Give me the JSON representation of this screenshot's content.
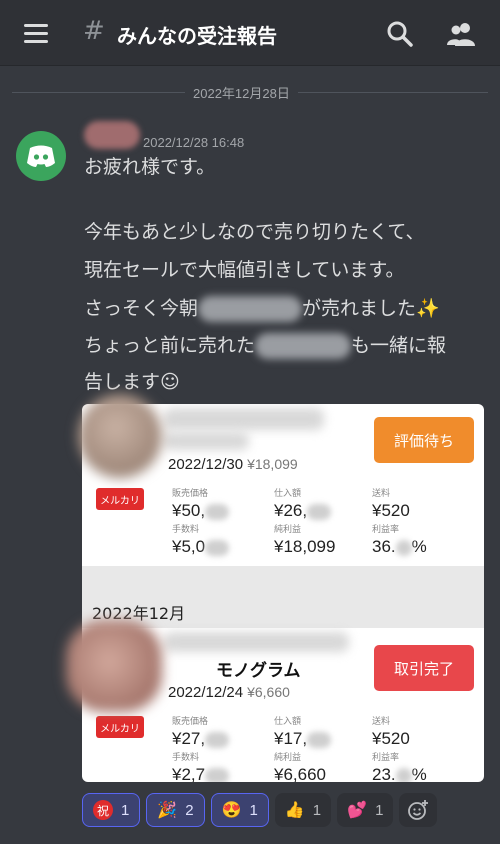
{
  "header": {
    "channel_hash": "#",
    "channel_name": "みんなの受注報告"
  },
  "date_separator": "2022年12月28日",
  "message": {
    "timestamp": "2022/12/28 16:48",
    "lines": {
      "l1": "お疲れ様です。",
      "l2": "今年もあと少しなので売り切りたくて、",
      "l3": "現在セールで大幅値引きしています。",
      "l4a": "さっそく今朝",
      "l4b": "が売れました✨",
      "l5a": "ちょっと前に売れた",
      "l5b": "も一緒に報",
      "l6": "告します☺"
    }
  },
  "card": {
    "items": [
      {
        "status": "評価待ち",
        "status_color": "#f08c2c",
        "platform": "メルカリ",
        "date": "2022/12/30",
        "price": "¥18,099",
        "labels": {
          "sale": "販売価格",
          "cost": "仕入額",
          "ship": "送料",
          "fee": "手数料",
          "profit": "純利益",
          "rate": "利益率"
        },
        "sale": "¥50,",
        "cost": "¥26,",
        "ship": "¥520",
        "fee": "¥5,0",
        "profit": "¥18,099",
        "rate_a": "36.",
        "rate_b": "%"
      },
      {
        "title": "モノグラム",
        "status": "取引完了",
        "status_color": "#e8474b",
        "platform": "メルカリ",
        "date": "2022/12/24",
        "price": "¥6,660",
        "labels": {
          "sale": "販売価格",
          "cost": "仕入額",
          "ship": "送料",
          "fee": "手数料",
          "profit": "純利益",
          "rate": "利益率"
        },
        "sale": "¥27,",
        "cost": "¥17,",
        "ship": "¥520",
        "fee": "¥2,7",
        "profit": "¥6,660",
        "rate_a": "23.",
        "rate_b": "%"
      }
    ],
    "month_label": "2022年12月"
  },
  "reactions": [
    {
      "icon": "iwai-icon",
      "glyph": "祝",
      "count": "1",
      "selected": true
    },
    {
      "icon": "party-popper-icon",
      "glyph": "🎉",
      "count": "2",
      "selected": true
    },
    {
      "icon": "heart-eyes-icon",
      "glyph": "😍",
      "count": "1",
      "selected": true
    },
    {
      "icon": "thumbs-up-icon",
      "glyph": "👍",
      "count": "1",
      "selected": false
    },
    {
      "icon": "two-hearts-icon",
      "glyph": "💕",
      "count": "1",
      "selected": false
    }
  ],
  "colors": {
    "accent": "#5865f2",
    "discord_green": "#3ba55d",
    "background": "#36393f"
  }
}
